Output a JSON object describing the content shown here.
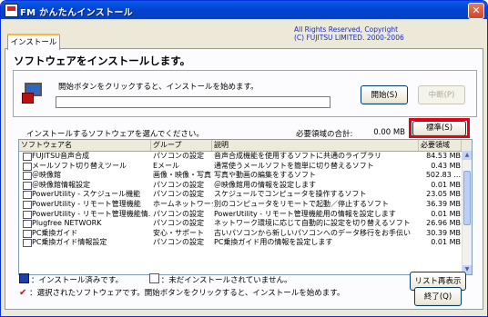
{
  "window": {
    "title": "FM かんたんインストール",
    "close": "✕"
  },
  "tab": {
    "label": "インストール"
  },
  "copyright": {
    "line1": "All Rights Reserved, Copyright",
    "line2": "(C) FUJITSU LIMITED. 2000-2006"
  },
  "heading": "ソフトウェアをインストールします。",
  "instruction": "開始ボタンをクリックすると、インストールを始めます。",
  "progress": {
    "percent": 0
  },
  "buttons": {
    "start": "開始(S)",
    "stop": "中断(P)",
    "standard": "標準(S)",
    "reload": "リスト再表示(L)",
    "exit": "終了(Q)"
  },
  "select_prompt": "インストールするソフトウェアを選んでください。",
  "total": {
    "label": "必要領域の合計:",
    "value": "0.00 MB"
  },
  "columns": [
    "ソフトウェア名",
    "グループ",
    "説明",
    "必要領域"
  ],
  "rows": [
    [
      "FUJITSU音声合成",
      "パソコンの設定",
      "音声合成機能を使用するソフトに共通のライブラリ",
      "84.53 MB"
    ],
    [
      "メールソフト切り替えツール",
      "Eメール",
      "通常使うメールソフトを簡単に切り替えるソフト",
      "0.43 MB"
    ],
    [
      "＠映像館",
      "画像・映像・写真",
      "写真や動画の編集をするソフト",
      "502.83 ..."
    ],
    [
      "＠映像館情報設定",
      "パソコンの設定",
      "＠映像館用の情報を設定します",
      "0.01 MB"
    ],
    [
      "PowerUtility - スケジュール機能",
      "パソコンの設定",
      "スケジュールでコンピュータを操作するソフト",
      "23.05 MB"
    ],
    [
      "PowerUtility - リモート管理機能",
      "ホームネットワーク",
      "別のコンピュータをリモートで起動／停止するソフト",
      "36.39 MB"
    ],
    [
      "PowerUtility - リモート管理機能情...",
      "パソコンの設定",
      "PowerUtility - リモート管理機能用の情報を設定します",
      "0.01 MB"
    ],
    [
      "Plugfree NETWORK",
      "パソコンの設定",
      "ネットワーク環境に応じて自動的に設定を切り替えるソフト",
      "26.96 MB"
    ],
    [
      "PC乗換ガイド",
      "安心・サポート",
      "古いパソコンから新しいパソコンへのデータ移行をお手伝い",
      "30.39 MB"
    ],
    [
      "PC乗換ガイド情報設定",
      "パソコンの設定",
      "PC乗換ガイド用の情報を設定します",
      "0.01 MB"
    ]
  ],
  "legend": {
    "installed": "：インストール済みです。",
    "not_installed": "：未だインストールされていません。",
    "selected": "：選択されたソフトウェアです。開始ボタンをクリックすると、インストールを始めます。"
  }
}
